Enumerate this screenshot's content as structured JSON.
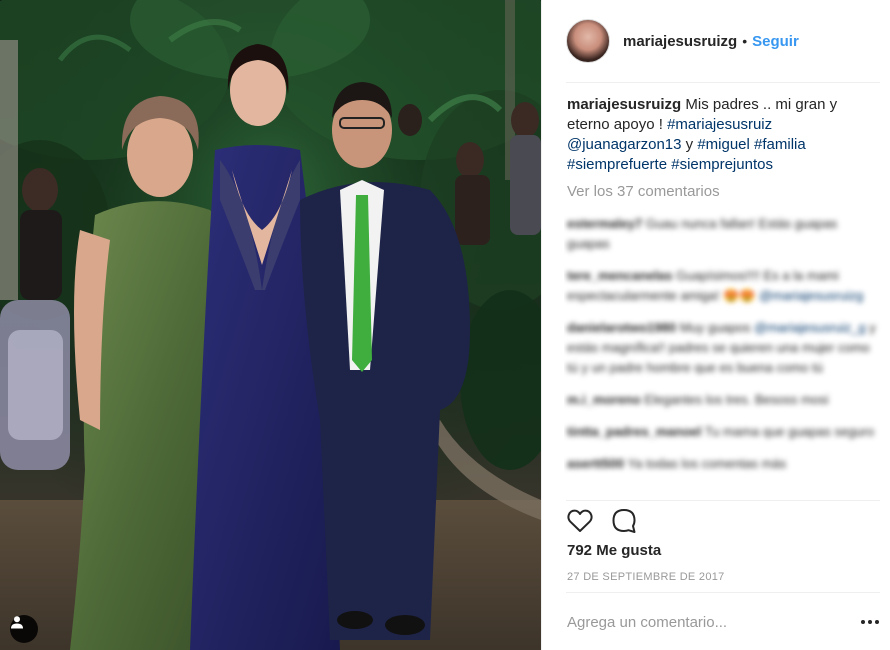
{
  "post": {
    "username": "mariajesusruizg",
    "separator": "•",
    "follow_label": "Seguir",
    "caption": {
      "user": "mariajesusruizg",
      "text_1": " Mis padres .. mi gran y eterno apoyo ! ",
      "tag_1": "#mariajesusruiz",
      "tag_2": "@juanagarzon13",
      "text_2": " y ",
      "tag_3": "#miguel",
      "tag_4": "#familia",
      "tag_5": "#siemprefuerte",
      "tag_6": "#siemprejuntos"
    },
    "view_comments_label": "Ver los 37 comentarios",
    "comments": [
      {
        "user": "estermaley7",
        "text": " Guau nunca fallan! Estás guapas guapas"
      },
      {
        "user": "tere_mencanelas",
        "text": " Guapísimos!!!! Es a la mami espectacularmente amiga! 😍😍",
        "tag": "@mariajesusruizg"
      },
      {
        "user": "danielarotwo1980",
        "text": " Muy guapos ",
        "tag": "@mariajesusruiz_g",
        "text_2": " y estás magnífica!! padres se quieren una mujer como tú y un padre hombre que es buena como tú"
      },
      {
        "user": "m.i_moreno",
        "text": " Elegantes los tres. Besoss mosi"
      },
      {
        "user": "tintta_padres_manoel",
        "text": " Tu mama que guapas seguro"
      },
      {
        "user": "asertt500",
        "text": " Ya todas los comentas más"
      }
    ],
    "likes_label": "792 Me gusta",
    "date_label": "27 DE SEPTIEMBRE DE 2017",
    "comment_placeholder": "Agrega un comentario...",
    "icons": {
      "like": "heart-icon",
      "comment": "comment-bubble-icon",
      "more": "more-options-icon",
      "user_tag": "user-tag-icon"
    },
    "colors": {
      "link": "#3897f0",
      "hashtag": "#003569",
      "muted": "#999999",
      "text": "#262626"
    }
  }
}
